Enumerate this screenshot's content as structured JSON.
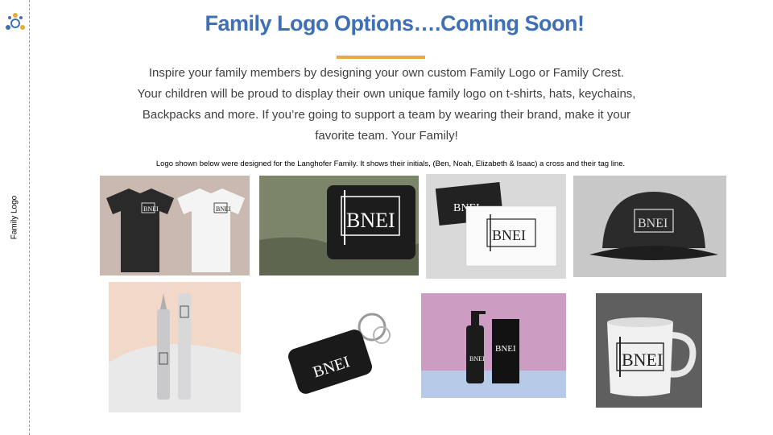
{
  "slide": {
    "title": "Family Logo Options….Coming Soon!",
    "intro_lines": [
      "Inspire your family members by designing your own custom Family Logo or Family Crest.",
      "Your children will be proud to display their own unique family logo on t-shirts, hats, keychains,",
      "Backpacks and more.  If you’re going to support a team by wearing their brand, make it your",
      "favorite team.  Your Family!"
    ],
    "caption": "Logo shown below were designed for the Langhofer Family.  It shows their initials, (Ben, Noah, Elizabeth & Isaac) a cross and their tag line.",
    "side_label": "Family Logo",
    "accent_color": "#3f6fb5",
    "underline_color": "#e2ad3d"
  },
  "logo": {
    "letters": "BNEI"
  },
  "mockups": [
    {
      "name": "t-shirts"
    },
    {
      "name": "pillow"
    },
    {
      "name": "business-cards"
    },
    {
      "name": "cap"
    },
    {
      "name": "pens"
    },
    {
      "name": "keychain"
    },
    {
      "name": "soap-bottle"
    },
    {
      "name": "mug"
    }
  ]
}
